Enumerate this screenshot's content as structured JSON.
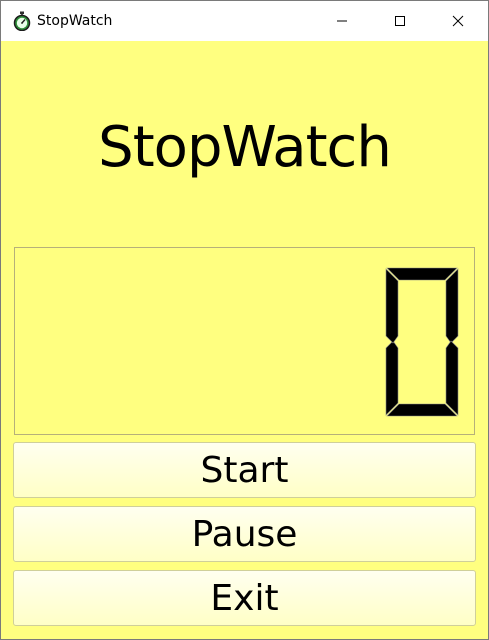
{
  "window": {
    "title": "StopWatch",
    "icon": "stopwatch-icon",
    "controls": [
      "minimize-icon",
      "maximize-icon",
      "close-icon"
    ]
  },
  "main": {
    "heading": "StopWatch",
    "display_value": "0",
    "buttons": {
      "start": "Start",
      "pause": "Pause",
      "exit": "Exit"
    }
  },
  "colors": {
    "background": "#ffff80",
    "segment_on": "#000000",
    "titlebar": "#ffffff"
  }
}
